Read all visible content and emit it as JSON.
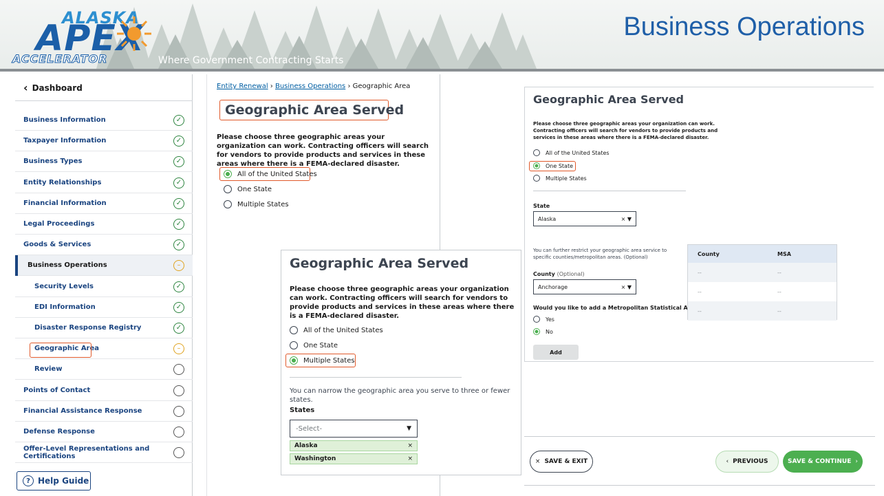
{
  "banner": {
    "logo_top": "ALASKA",
    "logo_mid": "APEX",
    "logo_bottom": "ACCELERATOR",
    "tagline": "Where Government Contracting Starts",
    "title": "Business Operations"
  },
  "sidebar": {
    "dashboard_label": "Dashboard",
    "items": [
      {
        "label": "Business Information",
        "status": "done"
      },
      {
        "label": "Taxpayer Information",
        "status": "done"
      },
      {
        "label": "Business Types",
        "status": "done"
      },
      {
        "label": "Entity Relationships",
        "status": "done"
      },
      {
        "label": "Financial Information",
        "status": "done"
      },
      {
        "label": "Legal Proceedings",
        "status": "done"
      },
      {
        "label": "Goods & Services",
        "status": "done"
      },
      {
        "label": "Business Operations",
        "status": "in-progress"
      },
      {
        "label": "Security Levels",
        "status": "done"
      },
      {
        "label": "EDI Information",
        "status": "done"
      },
      {
        "label": "Disaster Response Registry",
        "status": "done"
      },
      {
        "label": "Geographic Area",
        "status": "in-progress"
      },
      {
        "label": "Review",
        "status": "todo"
      },
      {
        "label": "Points of Contact",
        "status": "todo"
      },
      {
        "label": "Financial Assistance Response",
        "status": "todo"
      },
      {
        "label": "Defense Response",
        "status": "todo"
      },
      {
        "label": "Offer-Level Representations and Certifications",
        "status": "todo"
      }
    ],
    "help_label": "Help Guide"
  },
  "main": {
    "crumb_1": "Entity Renewal",
    "crumb_sep": "›",
    "crumb_2": "Business Operations",
    "crumb_3": "Geographic Area",
    "heading": "Geographic Area Served",
    "description": "Please choose three geographic areas your organization can work. Contracting officers will search for vendors to provide products and services in these areas where there is a FEMA-declared disaster.",
    "options": [
      "All of the United States",
      "One State",
      "Multiple States"
    ],
    "selected_option": "All of the United States"
  },
  "multi_card": {
    "heading": "Geographic Area Served",
    "description": "Please choose three geographic areas your organization can work. Contracting officers will search for vendors to provide products and services in these areas where there is a FEMA-declared disaster.",
    "options": [
      "All of the United States",
      "One State",
      "Multiple States"
    ],
    "selected_option": "Multiple States",
    "narrow_text": "You can narrow the geographic area you serve to three or fewer states.",
    "states_label": "States",
    "select_placeholder": "-Select-",
    "chips": [
      "Alaska",
      "Washington"
    ],
    "chip_remove": "×"
  },
  "state_card": {
    "heading": "Geographic Area Served",
    "description": "Please choose three geographic areas your organization can work. Contracting officers will search for vendors to provide products and services in these areas where there is a FEMA-declared disaster.",
    "options": [
      "All of the United States",
      "One State",
      "Multiple States"
    ],
    "selected_option": "One State",
    "state_label": "State",
    "state_value": "Alaska",
    "restrict_text": "You can further restrict your geographic area service to specific counties/metropolitan areas. (Optional)",
    "county_label": "County",
    "county_optional": "(Optional)",
    "county_value": "Anchorage",
    "msa_question": "Would you like to add a Metropolitan Statistical Area?",
    "yes": "Yes",
    "no": "No",
    "selected_msa": "No",
    "add_label": "Add",
    "table_headers": [
      "County",
      "MSA"
    ],
    "table_rows": [
      [
        "--",
        "--"
      ],
      [
        "--",
        "--"
      ],
      [
        "--",
        "--"
      ]
    ]
  },
  "actions": {
    "save_exit": "SAVE & EXIT",
    "previous": "PREVIOUS",
    "save_continue": "SAVE & CONTINUE"
  },
  "colors": {
    "primary_blue": "#1a4480",
    "complete_green": "#2e8540",
    "in_progress_amber": "#e0a423",
    "highlight_orange": "#e0592a",
    "continue_green": "#4caf50"
  }
}
